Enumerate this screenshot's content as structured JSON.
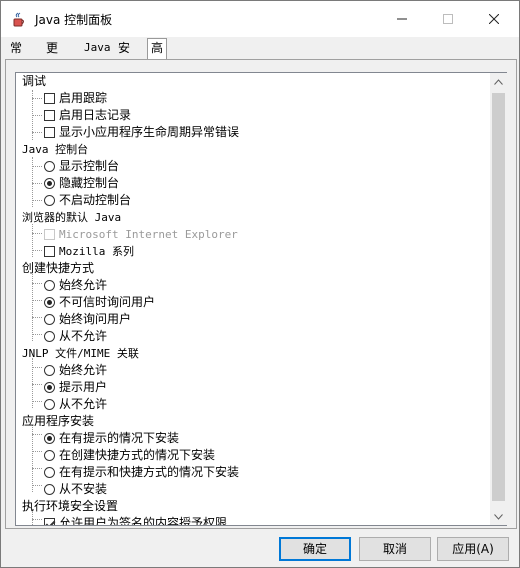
{
  "window": {
    "title": "Java 控制面板",
    "app_icon": "java-cup-icon"
  },
  "tabs": [
    {
      "label": "常规"
    },
    {
      "label": "更新"
    },
    {
      "label": "Java"
    },
    {
      "label": "安全"
    },
    {
      "label": "高级",
      "selected": true
    }
  ],
  "tree": {
    "debug": {
      "label": "调试",
      "items": [
        {
          "label": "启用跟踪",
          "checked": false
        },
        {
          "label": "启用日志记录",
          "checked": false
        },
        {
          "label": "显示小应用程序生命周期异常错误",
          "checked": false
        }
      ]
    },
    "console": {
      "label": "Java 控制台",
      "items": [
        {
          "label": "显示控制台",
          "checked": false
        },
        {
          "label": "隐藏控制台",
          "checked": true
        },
        {
          "label": "不启动控制台",
          "checked": false
        }
      ]
    },
    "browser": {
      "label": "浏览器的默认 Java",
      "items": [
        {
          "label": "Microsoft Internet Explorer",
          "checked": false,
          "disabled": true
        },
        {
          "label": "Mozilla 系列",
          "checked": false
        }
      ]
    },
    "shortcut": {
      "label": "创建快捷方式",
      "items": [
        {
          "label": "始终允许",
          "checked": false
        },
        {
          "label": "不可信时询问用户",
          "checked": true
        },
        {
          "label": "始终询问用户",
          "checked": false
        },
        {
          "label": "从不允许",
          "checked": false
        }
      ]
    },
    "jnlp": {
      "label": "JNLP 文件/MIME 关联",
      "items": [
        {
          "label": "始终允许",
          "checked": false
        },
        {
          "label": "提示用户",
          "checked": true
        },
        {
          "label": "从不允许",
          "checked": false
        }
      ]
    },
    "install": {
      "label": "应用程序安装",
      "items": [
        {
          "label": "在有提示的情况下安装",
          "checked": true
        },
        {
          "label": "在创建快捷方式的情况下安装",
          "checked": false
        },
        {
          "label": "在有提示和快捷方式的情况下安装",
          "checked": false
        },
        {
          "label": "从不安装",
          "checked": false
        }
      ]
    },
    "security": {
      "label": "执行环境安全设置",
      "items": [
        {
          "label": "允许用户为签名的内容授予权限",
          "checked": true
        }
      ]
    }
  },
  "buttons": {
    "ok": "确定",
    "cancel": "取消",
    "apply": "应用(A)"
  },
  "colors": {
    "window_bg": "#f0f0f0",
    "focus_border": "#0078d7"
  }
}
